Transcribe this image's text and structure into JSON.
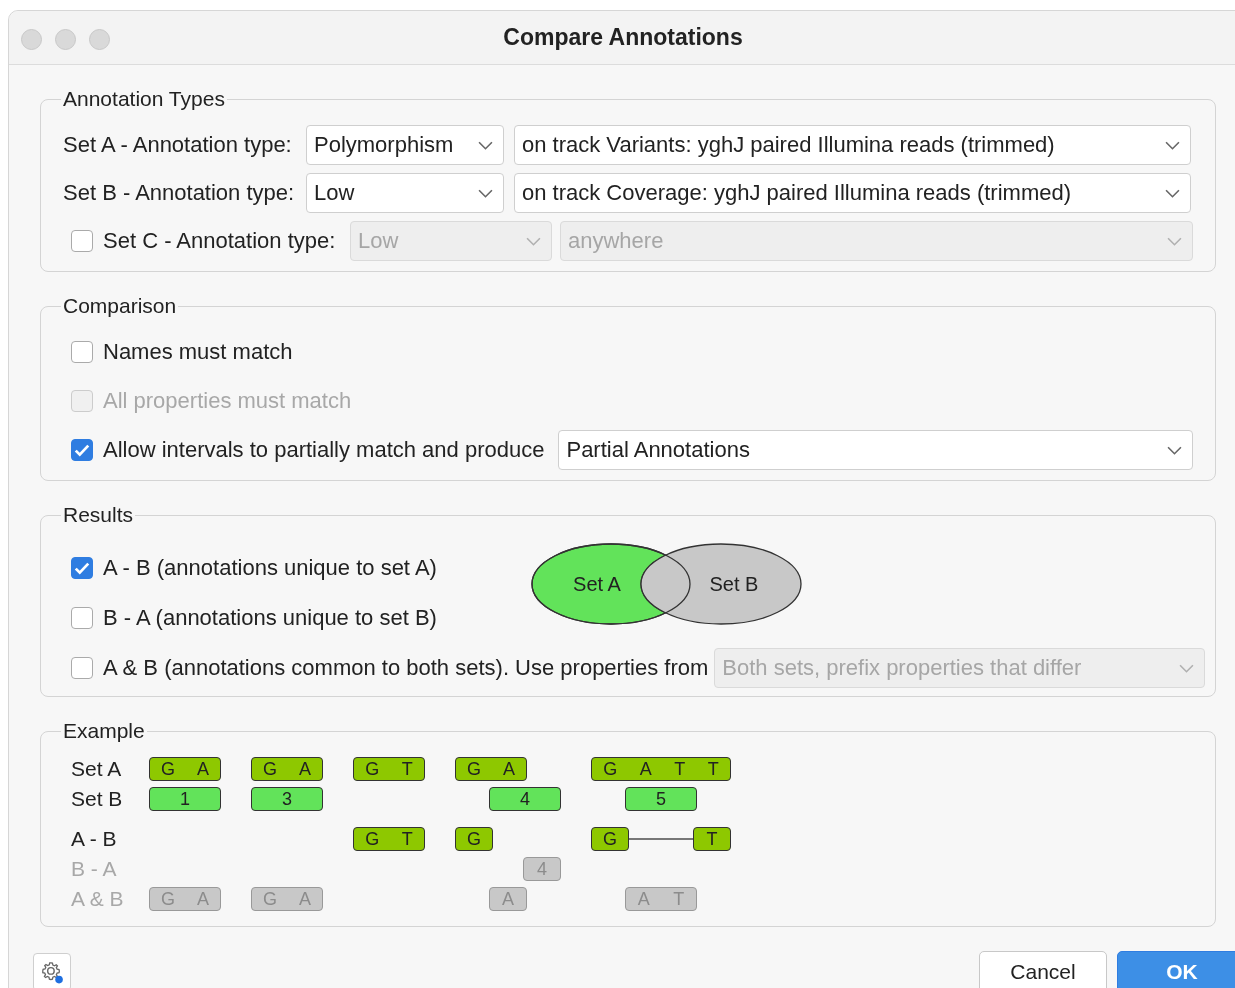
{
  "window": {
    "title": "Compare Annotations"
  },
  "annotation_types": {
    "title": "Annotation Types",
    "rows": [
      {
        "kind": "plain",
        "label": "Set A - Annotation type:",
        "type": {
          "value": "Polymorphism",
          "disabled": false
        },
        "track": {
          "value": "on track Variants: yghJ paired Illumina reads (trimmed)",
          "disabled": false
        }
      },
      {
        "kind": "plain",
        "label": "Set B - Annotation type:",
        "type": {
          "value": "Low",
          "disabled": false
        },
        "track": {
          "value": "on track Coverage: yghJ paired Illumina reads (trimmed)",
          "disabled": false
        }
      },
      {
        "kind": "checkbox",
        "checked": false,
        "label": "Set C - Annotation type:",
        "type": {
          "value": "Low",
          "disabled": true
        },
        "track": {
          "value": "anywhere",
          "disabled": true
        }
      }
    ]
  },
  "comparison": {
    "title": "Comparison",
    "options": [
      {
        "label": "Names must match",
        "checked": false,
        "disabled": false
      },
      {
        "label": "All properties must match",
        "checked": false,
        "disabled": true
      },
      {
        "label": "Allow intervals to partially match and produce",
        "checked": true,
        "disabled": false,
        "dropdown": {
          "value": "Partial Annotations",
          "disabled": false
        }
      }
    ]
  },
  "results": {
    "title": "Results",
    "options": [
      {
        "label": "A - B (annotations unique to set A)",
        "checked": true,
        "disabled": false
      },
      {
        "label": "B - A (annotations unique to set B)",
        "checked": false,
        "disabled": false
      },
      {
        "label": "A & B (annotations common to both sets). Use properties from",
        "checked": false,
        "disabled": false,
        "dropdown": {
          "value": "Both sets, prefix properties that differ",
          "disabled": true
        }
      }
    ],
    "venn": {
      "set_a": "Set A",
      "set_b": "Set B"
    }
  },
  "example": {
    "title": "Example",
    "groups": [
      [
        {
          "label": "Set A",
          "dimmed": false,
          "segments": [
            {
              "kind": "a",
              "text": [
                "G",
                "A"
              ]
            },
            {
              "kind": "a",
              "text": [
                "G",
                "A"
              ]
            },
            {
              "kind": "a",
              "text": [
                "G",
                "T"
              ]
            },
            {
              "kind": "a",
              "text": [
                "G",
                "A"
              ]
            },
            {
              "kind": "a",
              "text": [
                "G",
                "A",
                "T",
                "T"
              ]
            }
          ]
        },
        {
          "label": "Set B",
          "dimmed": false,
          "segments": [
            {
              "kind": "b",
              "text": [
                "1"
              ]
            },
            {
              "kind": "b",
              "text": [
                "3"
              ]
            },
            {
              "kind": "b",
              "text": [
                "4"
              ]
            },
            {
              "kind": "b",
              "text": [
                "5"
              ]
            }
          ]
        }
      ],
      [
        {
          "label": "A - B",
          "dimmed": false,
          "segments": [
            {
              "kind": "a",
              "text": [
                "G",
                "T"
              ]
            },
            {
              "kind": "a",
              "text": [
                "G"
              ]
            },
            {
              "kind": "a",
              "text": [
                "G"
              ]
            },
            {
              "kind": "link"
            },
            {
              "kind": "a",
              "text": [
                "T"
              ]
            }
          ]
        },
        {
          "label": "B - A",
          "dimmed": true,
          "segments": [
            {
              "kind": "grey",
              "text": [
                "4"
              ]
            }
          ]
        },
        {
          "label": "A & B",
          "dimmed": true,
          "segments": [
            {
              "kind": "grey",
              "text": [
                "G",
                "A"
              ]
            },
            {
              "kind": "grey",
              "text": [
                "G",
                "A"
              ]
            },
            {
              "kind": "grey",
              "text": [
                "A"
              ]
            },
            {
              "kind": "grey",
              "text": [
                "A",
                "T"
              ]
            }
          ]
        }
      ]
    ]
  },
  "buttons": [
    {
      "label": "Cancel",
      "kind": "secondary"
    },
    {
      "label": "OK",
      "kind": "primary"
    }
  ]
}
